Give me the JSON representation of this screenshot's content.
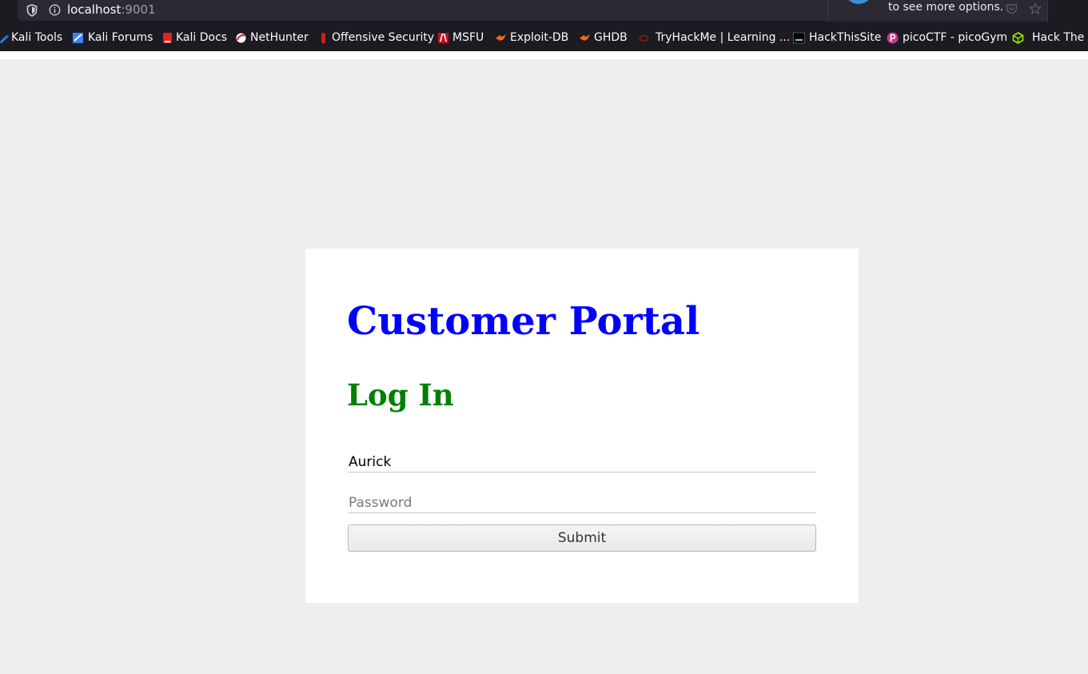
{
  "browser": {
    "url_host": "localhost",
    "url_port": ":9001",
    "popup_text": "to see more options."
  },
  "bookmarks": [
    {
      "label": "Kali Tools",
      "icon": "kali-dragon-icon",
      "color": "#2b7de9"
    },
    {
      "label": "Kali Forums",
      "icon": "kali-forums-icon",
      "color": "#3b82f6"
    },
    {
      "label": "Kali Docs",
      "icon": "kali-docs-icon",
      "color": "#e02424"
    },
    {
      "label": "NetHunter",
      "icon": "nethunter-icon",
      "color": "#e02424"
    },
    {
      "label": "Offensive Security",
      "icon": "offsec-icon",
      "color": "#d01f1f"
    },
    {
      "label": "MSFU",
      "icon": "msfu-icon",
      "color": "#c0111f"
    },
    {
      "label": "Exploit-DB",
      "icon": "exploitdb-icon",
      "color": "#f06a1d"
    },
    {
      "label": "GHDB",
      "icon": "ghdb-icon",
      "color": "#f06a1d"
    },
    {
      "label": "TryHackMe | Learning ...",
      "icon": "tryhackme-icon",
      "color": "#c0111f"
    },
    {
      "label": "HackThisSite",
      "icon": "hackthissite-icon",
      "color": "#000000"
    },
    {
      "label": "picoCTF - picoGym",
      "icon": "picoctf-icon",
      "color": "#c7378c"
    },
    {
      "label": "Hack The B",
      "icon": "hackthebox-icon",
      "color": "#9fef00"
    }
  ],
  "portal": {
    "title": "Customer Portal",
    "subtitle": "Log In",
    "username_value": "Aurick",
    "password_placeholder": "Password",
    "submit_label": "Submit"
  }
}
